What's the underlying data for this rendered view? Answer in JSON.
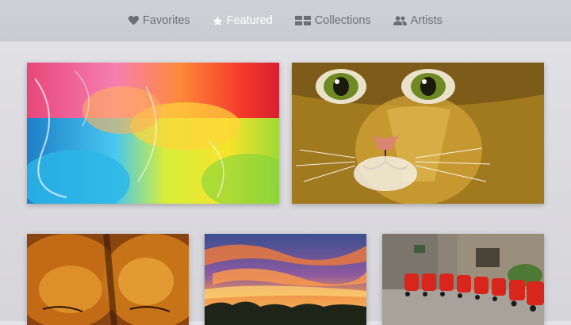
{
  "nav": {
    "tabs": [
      {
        "label": "Favorites",
        "icon": "heart-icon",
        "active": false
      },
      {
        "label": "Featured",
        "icon": "star-icon",
        "active": true
      },
      {
        "label": "Collections",
        "icon": "grid-icon",
        "active": false
      },
      {
        "label": "Artists",
        "icon": "people-icon",
        "active": false
      }
    ]
  },
  "artworks": [
    {
      "subject": "abstract colorful painting",
      "icon": "abstract-painting-thumbnail"
    },
    {
      "subject": "cat face painting",
      "icon": "cat-painting-thumbnail"
    },
    {
      "subject": "sleeping dog painting",
      "icon": "dog-painting-thumbnail"
    },
    {
      "subject": "sunset sky painting",
      "icon": "sunset-painting-thumbnail"
    },
    {
      "subject": "red scooters painting",
      "icon": "scooters-painting-thumbnail"
    }
  ],
  "colors": {
    "active_tab": "#ffffff",
    "inactive_tab": "#6d6e74",
    "topbar": "#cbcdd2"
  }
}
